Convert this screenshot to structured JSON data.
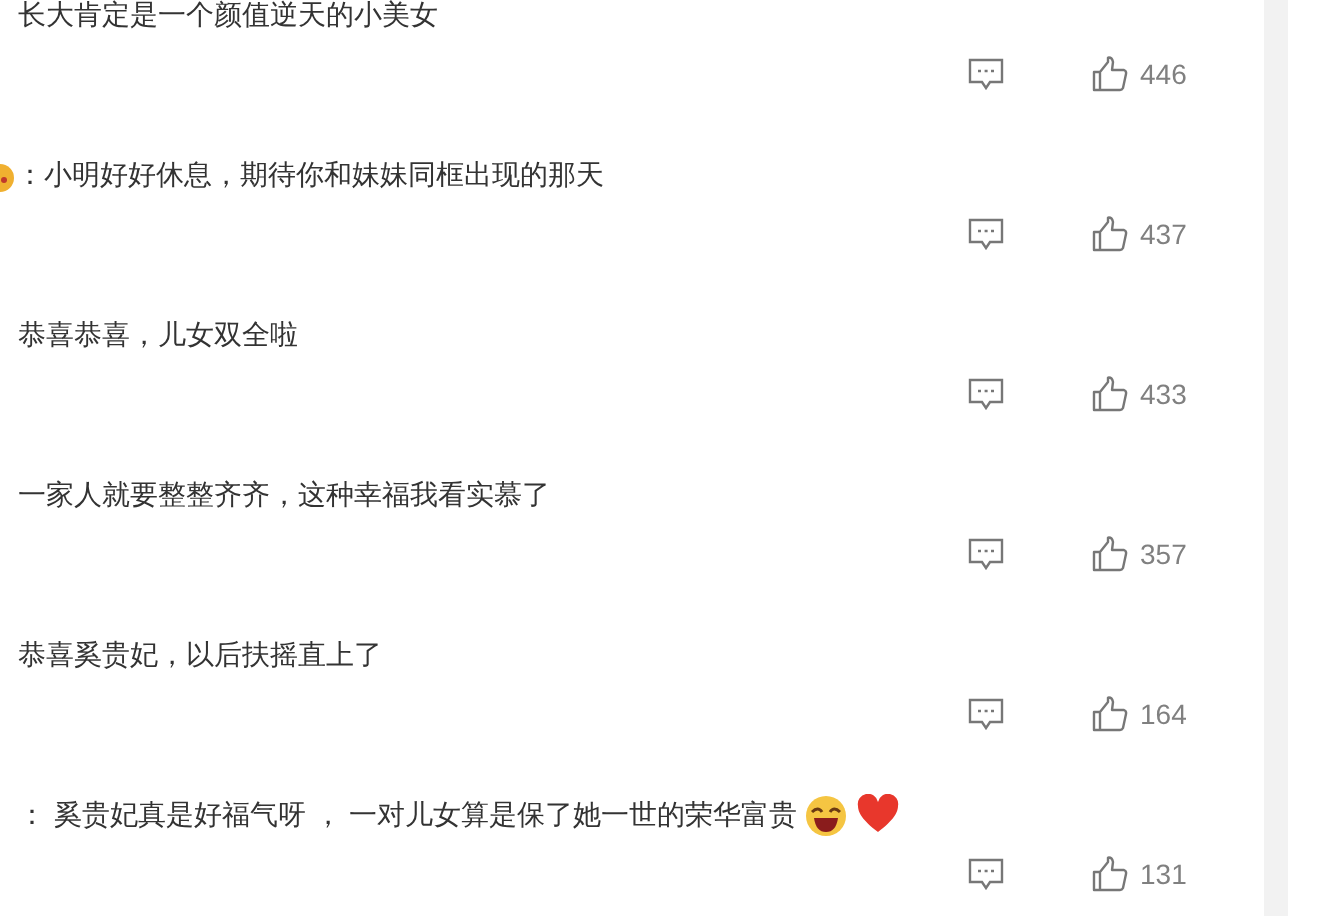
{
  "comments": [
    {
      "lead_icon": false,
      "text": "长大肯定是一个颜值逆天的小美女",
      "likes": "446"
    },
    {
      "lead_icon": true,
      "text": "：小明好好休息，期待你和妹妹同框出现的那天",
      "likes": "437"
    },
    {
      "lead_icon": false,
      "text": "恭喜恭喜，儿女双全啦",
      "likes": "433"
    },
    {
      "lead_icon": false,
      "text": "一家人就要整整齐齐，这种幸福我看实慕了",
      "likes": "357"
    },
    {
      "lead_icon": false,
      "text": "恭喜奚贵妃，以后扶摇直上了",
      "likes": "164"
    },
    {
      "lead_icon": false,
      "text": "：  奚贵妃真是好福气呀 ， 一对儿女算是保了她一世的荣华富贵",
      "emojis": [
        {
          "kind": "laugh"
        },
        {
          "kind": "heart"
        }
      ],
      "likes": "131"
    }
  ]
}
